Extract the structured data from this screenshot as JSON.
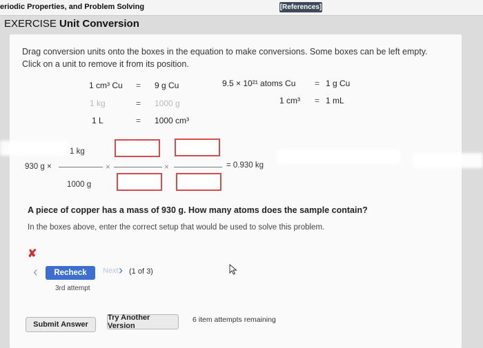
{
  "header": {
    "app_title": "eriodic Properties, and Problem Solving",
    "references_label": "[References]"
  },
  "exercise": {
    "label": "EXERCISE",
    "title": "Unit Conversion"
  },
  "instructions": {
    "line1": "Drag conversion units onto the boxes in the equation to make conversions. Some boxes can be left empty.",
    "line2": "Click on a unit to remove it from its position."
  },
  "units": {
    "r1_left": "1 cm³ Cu",
    "r1_right": "9 g Cu",
    "r2_left": "1 kg",
    "r2_right": "1000 g",
    "r3_left": "1 L",
    "r3_right": "1000 cm³",
    "c2r1_left": "9.5 × 10²¹ atoms Cu",
    "c2r1_right": "1 g Cu",
    "c2r2_left": "1 cm³",
    "c2r2_right": "1 mL",
    "equals": "="
  },
  "equation": {
    "start_value": "930 g",
    "times": "×",
    "numerator_1": "1 kg",
    "denominator_1": "1000 g",
    "result": "= 0.930 kg"
  },
  "question": {
    "text": "A piece of copper has a mass of 930 g. How many atoms does the sample contain?",
    "sub": "In the boxes above, enter the correct setup that would be used to solve this problem."
  },
  "feedback": {
    "wrong_mark": "✘"
  },
  "nav": {
    "back_icon": "‹",
    "recheck_label": "Recheck",
    "next_label": "Next",
    "next_icon": "›",
    "page_indicator": "(1 of 3)",
    "attempt": "3rd attempt"
  },
  "footer": {
    "submit_label": "Submit Answer",
    "try_another_label": "Try Another Version",
    "remaining": "6 item attempts remaining"
  },
  "colors": {
    "accent_blue": "#3d6fd1",
    "drop_box_border": "#d94b4b",
    "wrong_red": "#d32f2f",
    "references_bg": "#3d4a5a"
  }
}
